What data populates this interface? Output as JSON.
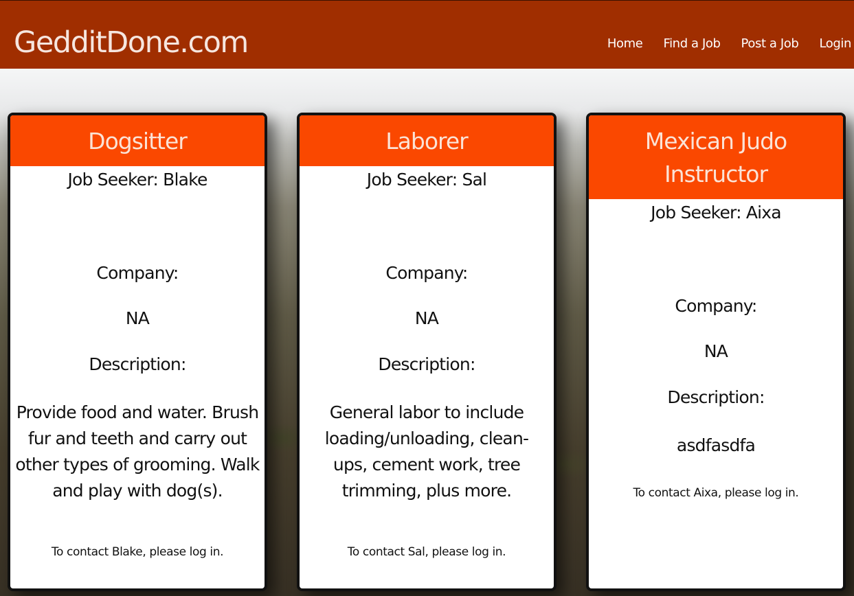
{
  "header": {
    "logo": "GedditDone.com",
    "nav": [
      "Home",
      "Find a Job",
      "Post a Job",
      "Login"
    ]
  },
  "cards": [
    {
      "title": "Dogsitter",
      "seeker": "Job Seeker: Blake",
      "company_label": "Company:",
      "company": "NA",
      "description_label": "Description:",
      "description": "Provide food and water. Brush fur and teeth and carry out other types of grooming. Walk and play with dog(s).",
      "contact": "To contact Blake, please log in."
    },
    {
      "title": "Laborer",
      "seeker": "Job Seeker: Sal",
      "company_label": "Company:",
      "company": "NA",
      "description_label": "Description:",
      "description": "General labor to include loading/unloading, clean-ups, cement work, tree trimming, plus more.",
      "contact": "To contact Sal, please log in."
    },
    {
      "title": "Mexican Judo Instructor",
      "seeker": "Job Seeker: Aixa",
      "company_label": "Company:",
      "company": "NA",
      "description_label": "Description:",
      "description": "asdfasdfa",
      "contact": "To contact Aixa, please log in."
    }
  ],
  "colors": {
    "header_bg": "#a02e00",
    "card_title_bg": "#fa4800",
    "card_title_text": "#fbe3d6"
  }
}
